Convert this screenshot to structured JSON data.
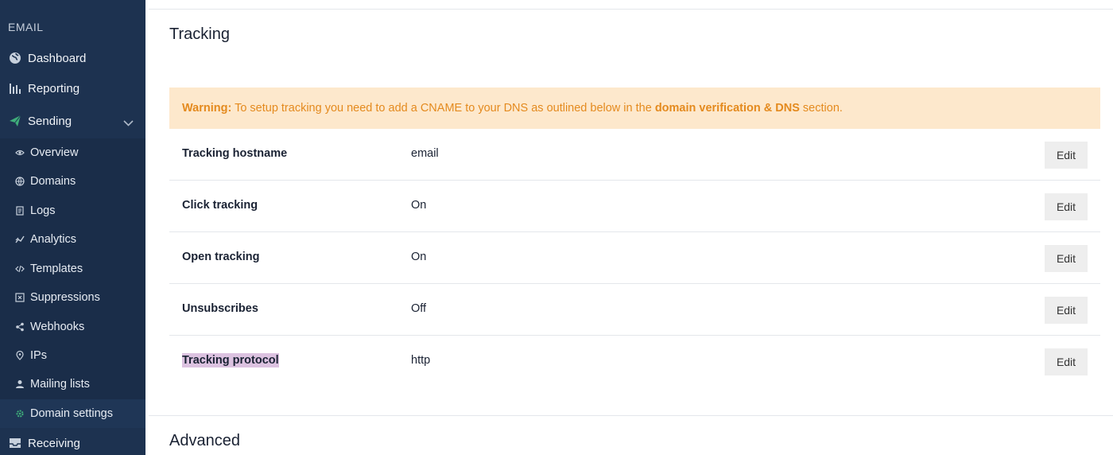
{
  "sidebar": {
    "section_label": "EMAIL",
    "items": [
      {
        "label": "Dashboard",
        "icon": "globe-icon"
      },
      {
        "label": "Reporting",
        "icon": "bar-chart-icon"
      },
      {
        "label": "Sending",
        "icon": "paper-plane-icon",
        "expanded": true
      }
    ],
    "sub_items": [
      {
        "label": "Overview",
        "icon": "eye-icon"
      },
      {
        "label": "Domains",
        "icon": "globe-icon"
      },
      {
        "label": "Logs",
        "icon": "document-icon"
      },
      {
        "label": "Analytics",
        "icon": "trend-icon"
      },
      {
        "label": "Templates",
        "icon": "code-icon"
      },
      {
        "label": "Suppressions",
        "icon": "block-icon"
      },
      {
        "label": "Webhooks",
        "icon": "share-icon"
      },
      {
        "label": "IPs",
        "icon": "pin-icon"
      },
      {
        "label": "Mailing lists",
        "icon": "user-icon"
      },
      {
        "label": "Domain settings",
        "icon": "gear-icon",
        "active": true
      }
    ],
    "receiving": {
      "label": "Receiving",
      "icon": "inbox-icon"
    }
  },
  "main": {
    "tracking_title": "Tracking",
    "warning": {
      "prefix": "Warning:",
      "text": " To setup tracking you need to add a CNAME to your DNS as outlined below in the ",
      "link": "domain verification & DNS",
      "suffix": " section."
    },
    "rows": [
      {
        "label": "Tracking hostname",
        "value": "email",
        "action": "Edit"
      },
      {
        "label": "Click tracking",
        "value": "On",
        "action": "Edit"
      },
      {
        "label": "Open tracking",
        "value": "On",
        "action": "Edit"
      },
      {
        "label": "Unsubscribes",
        "value": "Off",
        "action": "Edit"
      },
      {
        "label": "Tracking protocol",
        "value": "http",
        "action": "Edit"
      }
    ],
    "advanced_title": "Advanced"
  },
  "colors": {
    "sidebar_bg": "#1d3250",
    "active_icon": "#3fae7a",
    "warning_bg": "#fde8cc",
    "warning_text": "#e48a1e",
    "highlight": "#dcc2e0"
  }
}
